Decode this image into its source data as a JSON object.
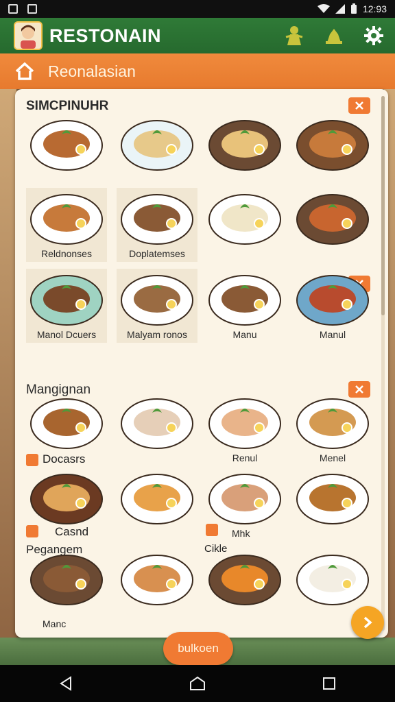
{
  "status_bar": {
    "time": "12:93"
  },
  "app_bar": {
    "title": "RESTONAIN",
    "actions": [
      {
        "icon": "chef-figure-icon"
      },
      {
        "icon": "hat-icon"
      },
      {
        "icon": "gear-icon"
      }
    ]
  },
  "sub_bar": {
    "title": "Reonalasian",
    "icon": "home-icon"
  },
  "sections": [
    {
      "title": "SIMCPINUHR"
    },
    {
      "title": "Mangignan"
    },
    {
      "title": "Pegangem"
    }
  ],
  "dishes": [
    {
      "label": ""
    },
    {
      "label": ""
    },
    {
      "label": ""
    },
    {
      "label": ""
    },
    {
      "label": "Reldnonses"
    },
    {
      "label": "Doplatemses"
    },
    {
      "label": ""
    },
    {
      "label": ""
    },
    {
      "label": "Manol Dcuers"
    },
    {
      "label": "Malyam ronos"
    },
    {
      "label": "Manu"
    },
    {
      "label": "Manul"
    },
    {
      "label": ""
    },
    {
      "label": ""
    },
    {
      "label": "Renul"
    },
    {
      "label": "Menel"
    },
    {
      "label": ""
    },
    {
      "label": ""
    },
    {
      "label": ""
    },
    {
      "label": ""
    },
    {
      "label": ""
    },
    {
      "label": ""
    },
    {
      "label": ""
    },
    {
      "label": ""
    }
  ],
  "floating_labels": {
    "docasrs": "Docasrs",
    "casnd": "Casnd",
    "mhk": "Mhk",
    "cikle": "Cikle",
    "manc": "Manc"
  },
  "bottom_button": {
    "label": "bulkoen"
  },
  "colors": {
    "app_bar": "#2f7a37",
    "sub_bar": "#f08a3c",
    "panel": "#fbf4e6",
    "accent": "#f07a33",
    "fab": "#f5a524"
  }
}
